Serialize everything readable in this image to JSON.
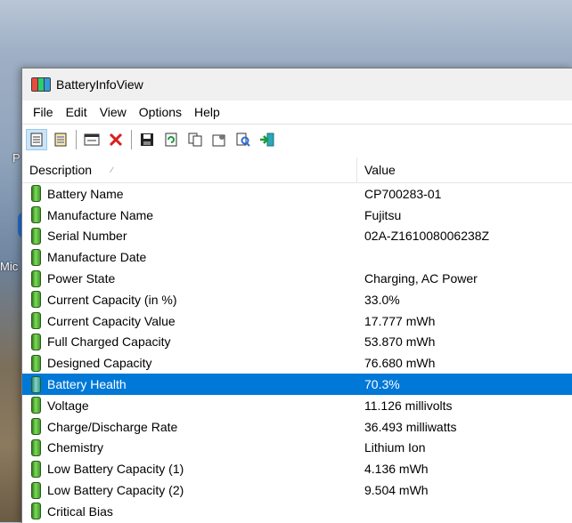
{
  "desktop": {
    "label_top": "P",
    "label_mid": "Mic"
  },
  "window": {
    "title": "BatteryInfoView"
  },
  "menu": [
    "File",
    "Edit",
    "View",
    "Options",
    "Help"
  ],
  "toolbar": {
    "buttons": [
      {
        "icon": "html-report-icon"
      },
      {
        "icon": "report-selected-icon"
      },
      {
        "icon": "properties-window-icon"
      },
      {
        "icon": "delete-icon"
      },
      {
        "icon": "save-icon"
      },
      {
        "icon": "refresh-icon"
      },
      {
        "icon": "copy-icon"
      },
      {
        "icon": "properties-icon"
      },
      {
        "icon": "find-icon"
      },
      {
        "icon": "exit-icon"
      }
    ]
  },
  "columns": {
    "description": "Description",
    "value": "Value"
  },
  "rows": [
    {
      "description": "Battery Name",
      "value": "CP700283-01"
    },
    {
      "description": "Manufacture Name",
      "value": "Fujitsu"
    },
    {
      "description": "Serial Number",
      "value": "02A-Z161008006238Z"
    },
    {
      "description": "Manufacture Date",
      "value": ""
    },
    {
      "description": "Power State",
      "value": "Charging, AC Power"
    },
    {
      "description": "Current Capacity (in %)",
      "value": "33.0%"
    },
    {
      "description": "Current Capacity Value",
      "value": "17.777 mWh"
    },
    {
      "description": "Full Charged Capacity",
      "value": "53.870 mWh"
    },
    {
      "description": "Designed Capacity",
      "value": "76.680 mWh"
    },
    {
      "description": "Battery Health",
      "value": "70.3%",
      "selected": true
    },
    {
      "description": "Voltage",
      "value": "11.126 millivolts"
    },
    {
      "description": "Charge/Discharge Rate",
      "value": "36.493 milliwatts"
    },
    {
      "description": "Chemistry",
      "value": "Lithium Ion"
    },
    {
      "description": "Low Battery Capacity (1)",
      "value": "4.136 mWh"
    },
    {
      "description": "Low Battery Capacity (2)",
      "value": "9.504 mWh"
    },
    {
      "description": "Critical Bias",
      "value": ""
    }
  ],
  "colors": {
    "selection": "#0078d7",
    "battery_icon": "#3c9b28"
  }
}
